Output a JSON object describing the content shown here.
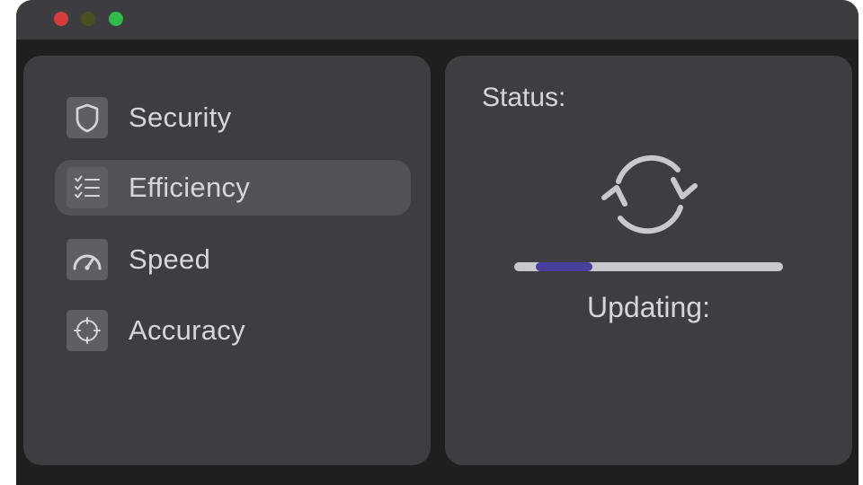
{
  "window": {
    "controls": {
      "close_color": "#d43d3c",
      "minimize_color": "#4c5020",
      "maximize_color": "#2fba4a"
    }
  },
  "sidebar": {
    "items": [
      {
        "label": "Security",
        "icon": "shield-icon",
        "active": false
      },
      {
        "label": "Efficiency",
        "icon": "checklist-icon",
        "active": true
      },
      {
        "label": "Speed",
        "icon": "speedometer-icon",
        "active": false
      },
      {
        "label": "Accuracy",
        "icon": "crosshair-icon",
        "active": false
      }
    ]
  },
  "status_panel": {
    "status_label": "Status:",
    "sync_icon": "sync-icon",
    "progress": {
      "start_fraction": 0.08,
      "end_fraction": 0.29
    },
    "updating_label": "Updating:"
  },
  "colors": {
    "window_bg": "#1f1f21",
    "panel_bg": "#3e3d41",
    "active_item_bg": "#525155",
    "text": "#d6d5d9",
    "progress_track": "#c8c7cb",
    "progress_fill": "#4a3f9c"
  }
}
